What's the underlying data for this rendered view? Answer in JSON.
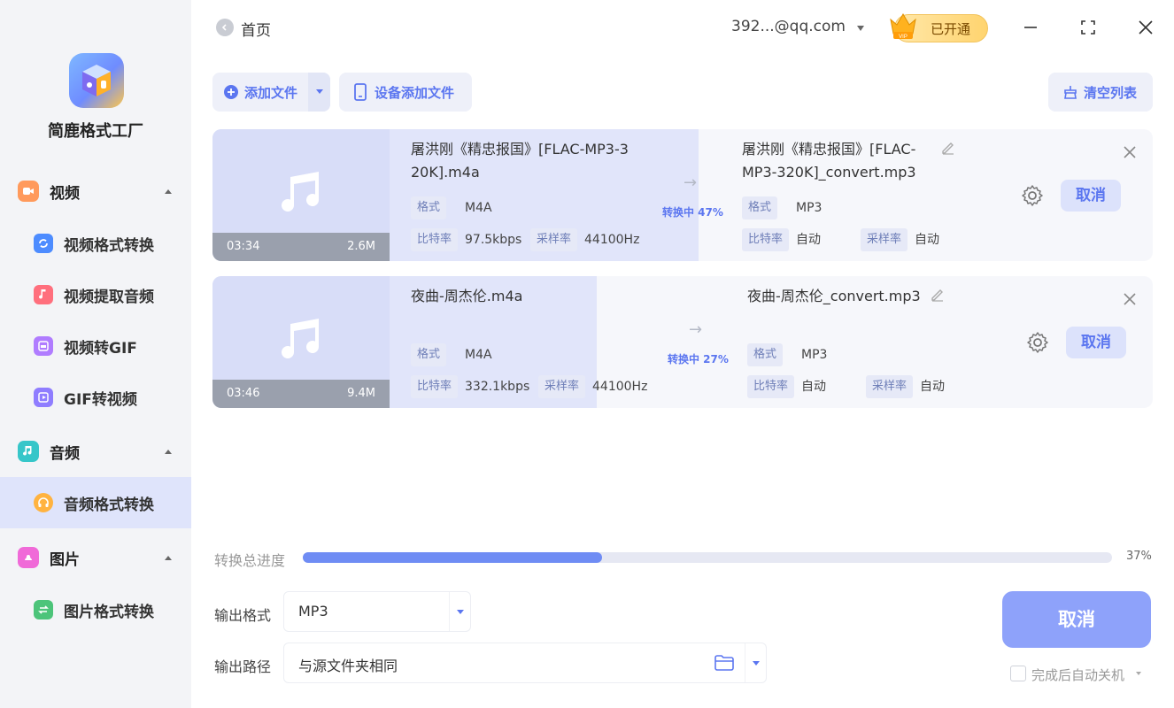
{
  "app": {
    "name": "简鹿格式工厂"
  },
  "sidebar": {
    "categories": [
      {
        "label": "视频",
        "items": [
          {
            "label": "视频格式转换"
          },
          {
            "label": "视频提取音频"
          },
          {
            "label": "视频转GIF"
          },
          {
            "label": "GIF转视频"
          }
        ]
      },
      {
        "label": "音频",
        "items": [
          {
            "label": "音频格式转换",
            "active": true
          }
        ]
      },
      {
        "label": "图片",
        "items": [
          {
            "label": "图片格式转换"
          }
        ]
      }
    ]
  },
  "topbar": {
    "back_label": "首页",
    "account": "392...@qq.com",
    "vip_label": "已开通"
  },
  "toolbar": {
    "add_file": "添加文件",
    "device_add": "设备添加文件",
    "clear_list": "清空列表"
  },
  "files": [
    {
      "source_name_line1": "屠洪刚《精忠报国》[FLAC-MP3-3",
      "source_name_line2": "20K].m4a",
      "duration": "03:34",
      "size": "2.6M",
      "format_tag": "格式",
      "format": "M4A",
      "bitrate_tag": "比特率",
      "bitrate": "97.5kbps",
      "samplerate_tag": "采样率",
      "samplerate": "44100Hz",
      "status": "转换中 47%",
      "progress": 0.47,
      "output_name_line1": "屠洪刚《精忠报国》[FLAC-",
      "output_name_line2": "MP3-320K]_convert.mp3",
      "out_format": "MP3",
      "out_bitrate": "自动",
      "out_samplerate": "自动",
      "cancel": "取消"
    },
    {
      "source_name_line1": "夜曲-周杰伦.m4a",
      "source_name_line2": "",
      "duration": "03:46",
      "size": "9.4M",
      "format_tag": "格式",
      "format": "M4A",
      "bitrate_tag": "比特率",
      "bitrate": "332.1kbps",
      "samplerate_tag": "采样率",
      "samplerate": "44100Hz",
      "status": "转换中 27%",
      "progress": 0.27,
      "output_name_line1": "夜曲-周杰伦_convert.mp3",
      "output_name_line2": "",
      "out_format": "MP3",
      "out_bitrate": "自动",
      "out_samplerate": "自动",
      "cancel": "取消"
    }
  ],
  "bottom": {
    "total_label": "转换总进度",
    "total_progress": 0.37,
    "total_pct": "37%",
    "output_format_label": "输出格式",
    "output_format": "MP3",
    "output_path_label": "输出路径",
    "output_path": "与源文件夹相同",
    "cancel_all": "取消",
    "auto_shutdown": "完成后自动关机"
  },
  "colors": {
    "accent": "#5b76f0",
    "active_nav": "#dfe4fb",
    "progress_row": "#e1e5fa"
  }
}
